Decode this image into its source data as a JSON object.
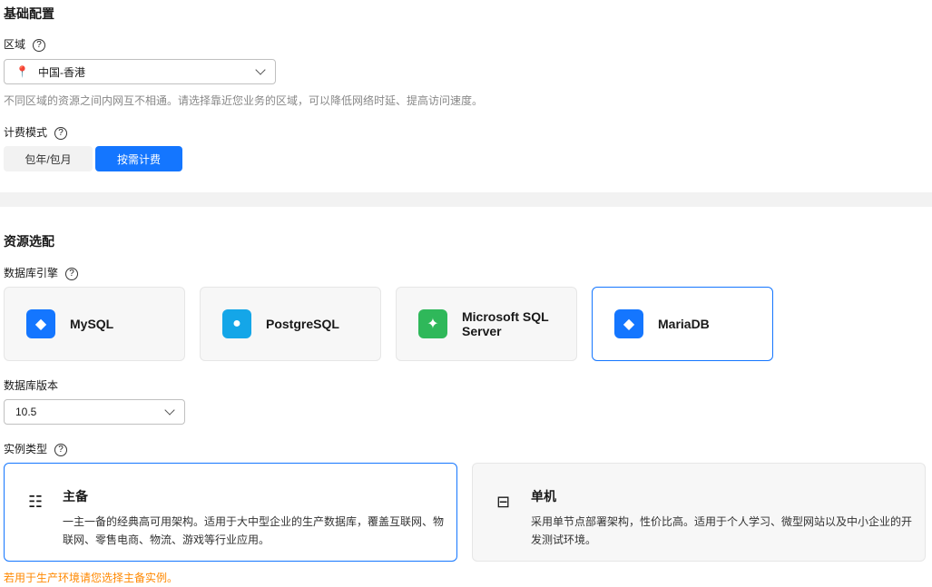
{
  "basic": {
    "title": "基础配置",
    "region_label": "区域",
    "region_value": "中国-香港",
    "region_hint": "不同区域的资源之间内网互不相通。请选择靠近您业务的区域，可以降低网络时延、提高访问速度。",
    "billing_label": "计费模式",
    "billing_options": [
      "包年/包月",
      "按需计费"
    ]
  },
  "resource": {
    "title": "资源选配",
    "engine_label": "数据库引擎",
    "engines": [
      "MySQL",
      "PostgreSQL",
      "Microsoft SQL Server",
      "MariaDB"
    ],
    "version_label": "数据库版本",
    "version_value": "10.5",
    "type_label": "实例类型",
    "types": [
      {
        "title": "主备",
        "desc": "一主一备的经典高可用架构。适用于大中型企业的生产数据库，覆盖互联网、物联网、零售电商、物流、游戏等行业应用。"
      },
      {
        "title": "单机",
        "desc": "采用单节点部署架构，性价比高。适用于个人学习、微型网站以及中小企业的开发测试环境。"
      }
    ],
    "warning": "若用于生产环境请您选择主备实例。"
  },
  "colors": {
    "accent": "#1476ff",
    "warning": "#ff8800"
  }
}
